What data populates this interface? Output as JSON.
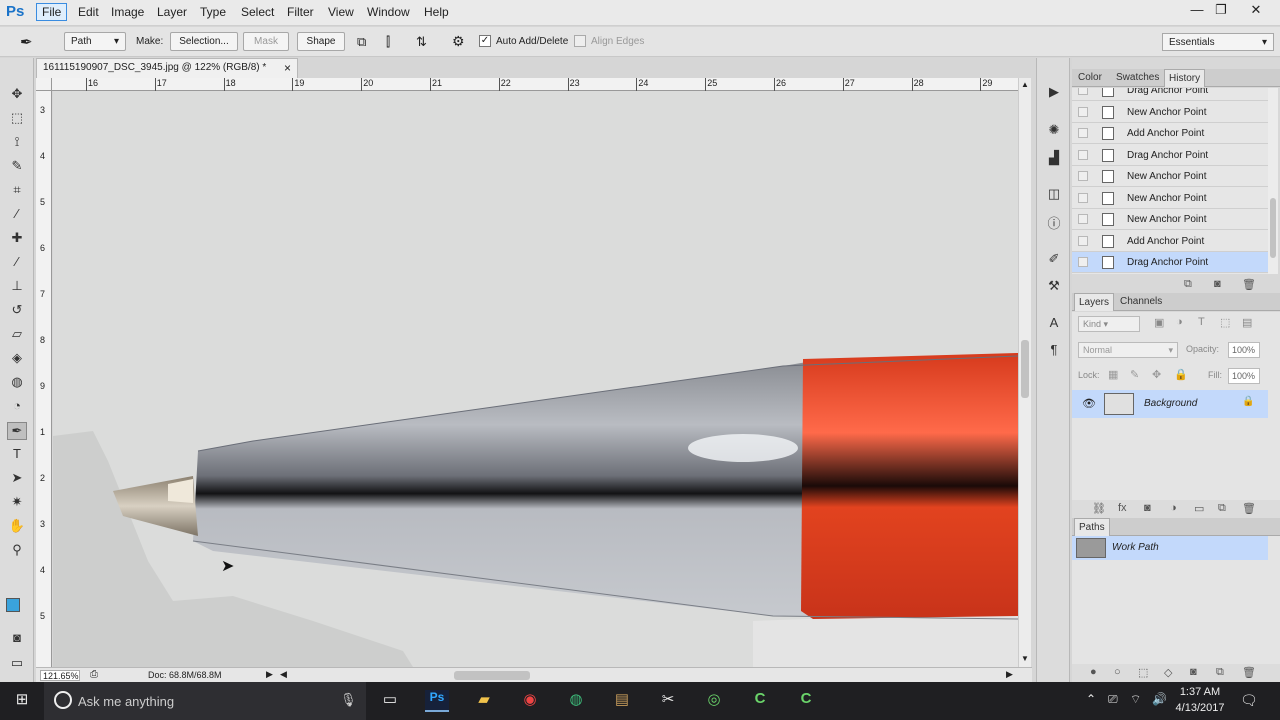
{
  "app": {
    "logo": "Ps"
  },
  "menu": [
    "File",
    "Edit",
    "Image",
    "Layer",
    "Type",
    "Select",
    "Filter",
    "View",
    "Window",
    "Help"
  ],
  "window_controls": [
    "—",
    "❐",
    "✕"
  ],
  "options_bar": {
    "mode": "Path",
    "make_label": "Make:",
    "selection_btn": "Selection...",
    "mask_btn": "Mask",
    "shape_btn": "Shape",
    "auto_add_delete": "Auto Add/Delete",
    "align_edges": "Align Edges",
    "workspace": "Essentials"
  },
  "tools": [
    {
      "name": "move-tool-icon",
      "glyph": "✥"
    },
    {
      "name": "marquee-tool-icon",
      "glyph": "⬚"
    },
    {
      "name": "lasso-tool-icon",
      "glyph": "⟟"
    },
    {
      "name": "quick-select-tool-icon",
      "glyph": "✎"
    },
    {
      "name": "crop-tool-icon",
      "glyph": "⌗"
    },
    {
      "name": "eyedropper-tool-icon",
      "glyph": "⁄"
    },
    {
      "name": "healing-brush-tool-icon",
      "glyph": "✚"
    },
    {
      "name": "brush-tool-icon",
      "glyph": "⁄"
    },
    {
      "name": "clone-stamp-tool-icon",
      "glyph": "⊥"
    },
    {
      "name": "history-brush-tool-icon",
      "glyph": "↺"
    },
    {
      "name": "eraser-tool-icon",
      "glyph": "▱"
    },
    {
      "name": "paint-bucket-tool-icon",
      "glyph": "◈"
    },
    {
      "name": "blur-tool-icon",
      "glyph": "◍"
    },
    {
      "name": "dodge-tool-icon",
      "glyph": "◔"
    },
    {
      "name": "pen-tool-icon",
      "glyph": "✒"
    },
    {
      "name": "type-tool-icon",
      "glyph": "T"
    },
    {
      "name": "path-select-tool-icon",
      "glyph": "➤"
    },
    {
      "name": "shape-tool-icon",
      "glyph": "✷"
    },
    {
      "name": "hand-tool-icon",
      "glyph": "✋"
    },
    {
      "name": "zoom-tool-icon",
      "glyph": "⚲"
    }
  ],
  "document": {
    "tab_title": "161115190907_DSC_3945.jpg @ 122% (RGB/8) *",
    "close": "×",
    "ruler_top": [
      "16",
      "17",
      "18",
      "19",
      "20",
      "21",
      "22",
      "23",
      "24",
      "25",
      "26",
      "27",
      "28",
      "29"
    ],
    "ruler_left": [
      "3",
      "4",
      "5",
      "6",
      "7",
      "8",
      "9",
      "1",
      "2",
      "3",
      "4",
      "5"
    ],
    "zoom": "121.65%",
    "doc_size": "Doc: 68.8M/68.8M"
  },
  "panels": {
    "top_tabs": [
      "Color",
      "Swatches",
      "History"
    ],
    "history": [
      "Drag Anchor Point",
      "New Anchor Point",
      "Add Anchor Point",
      "Drag Anchor Point",
      "New Anchor Point",
      "New Anchor Point",
      "New Anchor Point",
      "Add Anchor Point",
      "Drag Anchor Point"
    ],
    "layers_tabs": [
      "Layers",
      "Channels"
    ],
    "kind": "Kind",
    "blend": "Normal",
    "opacity_label": "Opacity:",
    "opacity": "100%",
    "lock_label": "Lock:",
    "fill_label": "Fill:",
    "fill": "100%",
    "layer_name": "Background",
    "paths_tab": "Paths",
    "path_name": "Work Path"
  },
  "taskbar": {
    "search_placeholder": "Ask me anything",
    "time": "1:37 AM",
    "date": "4/13/2017"
  }
}
